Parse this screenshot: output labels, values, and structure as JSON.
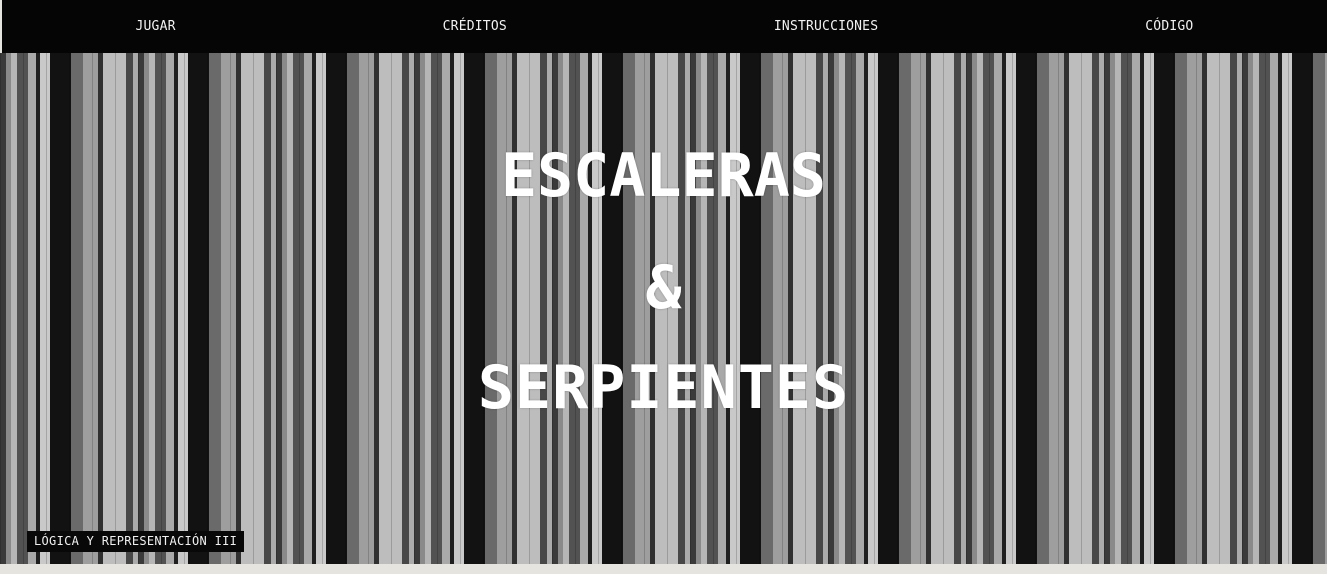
{
  "nav": {
    "items": [
      {
        "label": "JUGAR"
      },
      {
        "label": "CRÉDITOS"
      },
      {
        "label": "INSTRUCCIONES"
      },
      {
        "label": "CÓDIGO"
      }
    ]
  },
  "hero": {
    "title_line1": "ESCALERAS",
    "title_amp": "&",
    "title_line2": "SERPIENTES"
  },
  "footer": {
    "course_label": "LÓGICA Y REPRESENTACIÓN III"
  },
  "colors": {
    "nav_background": "#050505",
    "nav_text": "#f2f2f2",
    "title_text": "#ffffff",
    "page_background": "#e6e4df"
  }
}
